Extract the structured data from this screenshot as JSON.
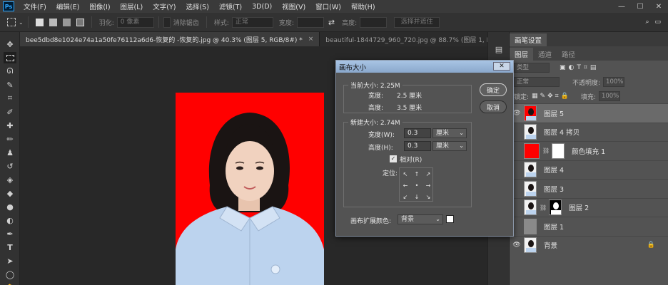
{
  "menubar": {
    "logo": "Ps",
    "items": [
      "文件(F)",
      "编辑(E)",
      "图像(I)",
      "图层(L)",
      "文字(Y)",
      "选择(S)",
      "滤镜(T)",
      "3D(D)",
      "视图(V)",
      "窗口(W)",
      "帮助(H)"
    ],
    "window_controls": [
      "—",
      "☐",
      "✕"
    ]
  },
  "options": {
    "feather_label": "羽化:",
    "feather_value": "0 像素",
    "antialias": "消除锯齿",
    "style_label": "样式:",
    "style_value": "正常",
    "width_label": "宽度:",
    "height_label": "高度:",
    "select_mask": "选择并遮住 ..."
  },
  "tabs": [
    {
      "label": "bee5dbd8e1024e74a1a50fe76112a6d6-恢复的 -恢复的.jpg @ 40.3% (图层 5, RGB/8#) *",
      "close": "×"
    },
    {
      "label": "beautiful-1844729_960_720.jpg @ 88.7% (图层 1, RGB/8#) *",
      "close": "×"
    }
  ],
  "panel": {
    "top_tab": "画笔设置",
    "tabs": [
      "图层",
      "通道",
      "路径"
    ],
    "kind_label": "类型",
    "blend_mode": "正常",
    "opacity_label": "不透明度:",
    "opacity_value": "100%",
    "lock_label": "锁定:",
    "fill_label": "填充:",
    "fill_value": "100%",
    "layers": [
      {
        "name": "图层 5",
        "thumb": "photo-red",
        "visible": true,
        "selected": true
      },
      {
        "name": "图层 4 拷贝",
        "thumb": "photo",
        "visible": false,
        "selected": false
      },
      {
        "name": "颜色填充 1",
        "thumb": "red-fill",
        "visible": false,
        "selected": false
      },
      {
        "name": "图层 4",
        "thumb": "photo",
        "visible": false,
        "selected": false
      },
      {
        "name": "图层 3",
        "thumb": "photo",
        "visible": false,
        "selected": false
      },
      {
        "name": "图层 2",
        "thumb": "photo-mask",
        "visible": false,
        "selected": false
      },
      {
        "name": "图层 1",
        "thumb": "gray",
        "visible": false,
        "selected": false
      },
      {
        "name": "背景",
        "thumb": "photo",
        "visible": true,
        "selected": false
      }
    ]
  },
  "dialog": {
    "title": "画布大小",
    "current_group": "当前大小: 2.25M",
    "current_width_label": "宽度:",
    "current_width_value": "2.5 厘米",
    "current_height_label": "高度:",
    "current_height_value": "3.5 厘米",
    "new_group": "新建大小: 2.74M",
    "width_label": "宽度(W):",
    "width_value": "0.3",
    "width_unit": "厘米",
    "height_label": "高度(H):",
    "height_value": "0.3",
    "height_unit": "厘米",
    "relative_label": "相对(R)",
    "anchor_label": "定位:",
    "anchor_arrows": [
      "↖",
      "↑",
      "↗",
      "←",
      "•",
      "→",
      "↙",
      "↓",
      "↘"
    ],
    "ext_color_label": "画布扩展颜色:",
    "ext_color_value": "背景",
    "ok": "确定",
    "cancel": "取消",
    "close": "✕"
  },
  "colors": {
    "canvas_red": "#ff0000",
    "shirt": "#bcd3ee",
    "dialog_title": "#a8c4e4"
  }
}
